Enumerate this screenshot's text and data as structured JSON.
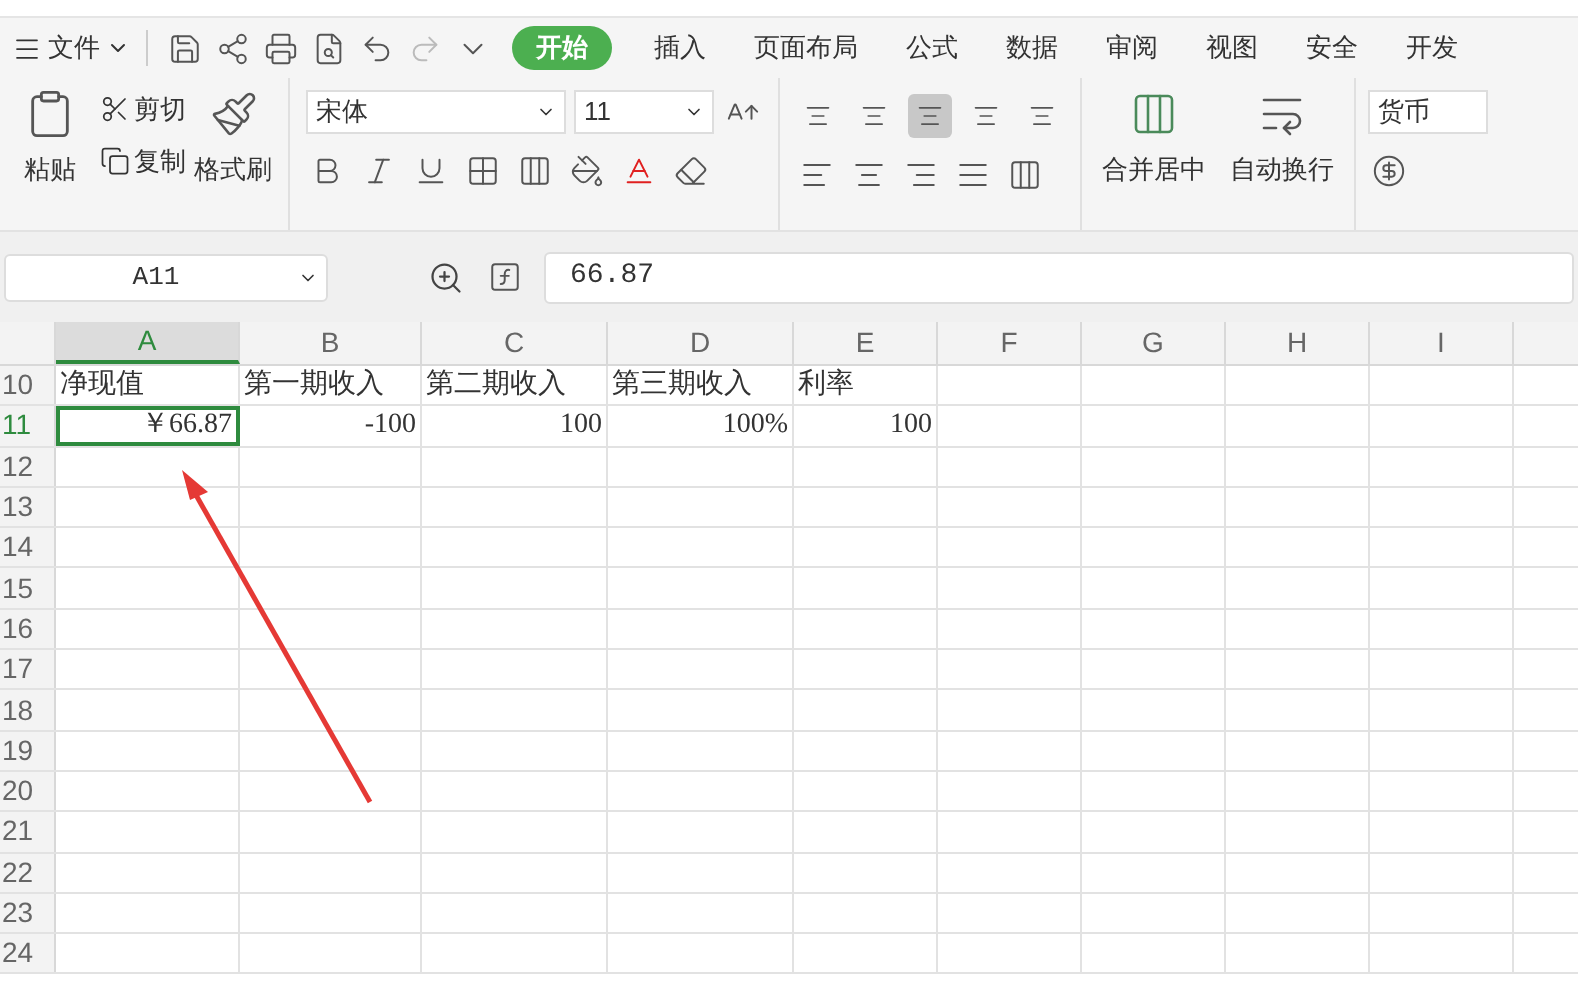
{
  "menu": {
    "label": "文件"
  },
  "tabs": [
    {
      "label": "开始",
      "selected": true
    },
    {
      "label": "插入",
      "selected": false
    },
    {
      "label": "页面布局",
      "selected": false
    },
    {
      "label": "公式",
      "selected": false
    },
    {
      "label": "数据",
      "selected": false
    },
    {
      "label": "审阅",
      "selected": false
    },
    {
      "label": "视图",
      "selected": false
    },
    {
      "label": "安全",
      "selected": false
    },
    {
      "label": "开发",
      "selected": false
    }
  ],
  "clipboard": {
    "paste": "粘贴",
    "cut": "剪切",
    "copy": "复制",
    "format_painter": "格式刷"
  },
  "font": {
    "name": "宋体",
    "size": "11"
  },
  "alignment": [
    {
      "selected": false
    },
    {
      "selected": false
    },
    {
      "selected": true
    },
    {
      "selected": false
    },
    {
      "selected": false
    }
  ],
  "merge": {
    "label": "合并居中"
  },
  "wrap": {
    "label": "自动换行"
  },
  "number_format": {
    "value": "货币"
  },
  "formula_bar": {
    "name_box": "A11",
    "value": "66.87"
  },
  "columns": [
    {
      "label": "A",
      "selected": true
    },
    {
      "label": "B",
      "selected": false
    },
    {
      "label": "C",
      "selected": false
    },
    {
      "label": "D",
      "selected": false
    },
    {
      "label": "E",
      "selected": false
    },
    {
      "label": "F",
      "selected": false
    },
    {
      "label": "G",
      "selected": false
    },
    {
      "label": "H",
      "selected": false
    },
    {
      "label": "I",
      "selected": false
    }
  ],
  "rows": [
    {
      "number": "10",
      "selected": false,
      "cells": [
        {
          "text": "净现值",
          "kind": "text"
        },
        {
          "text": "第一期收入",
          "kind": "text"
        },
        {
          "text": "第二期收入",
          "kind": "text"
        },
        {
          "text": "第三期收入",
          "kind": "text"
        },
        {
          "text": "利率",
          "kind": "text"
        }
      ]
    },
    {
      "number": "11",
      "selected": true,
      "cells": [
        {
          "text": "￥66.87",
          "kind": "number",
          "selected": true
        },
        {
          "text": "-100",
          "kind": "number"
        },
        {
          "text": "100",
          "kind": "number"
        },
        {
          "text": "100%",
          "kind": "number"
        },
        {
          "text": "100",
          "kind": "number"
        }
      ]
    },
    {
      "number": "12",
      "selected": false,
      "cells": []
    },
    {
      "number": "13",
      "selected": false,
      "cells": []
    },
    {
      "number": "14",
      "selected": false,
      "cells": []
    },
    {
      "number": "15",
      "selected": false,
      "cells": []
    },
    {
      "number": "16",
      "selected": false,
      "cells": []
    },
    {
      "number": "17",
      "selected": false,
      "cells": []
    },
    {
      "number": "18",
      "selected": false,
      "cells": []
    },
    {
      "number": "19",
      "selected": false,
      "cells": []
    },
    {
      "number": "20",
      "selected": false,
      "cells": []
    },
    {
      "number": "21",
      "selected": false,
      "cells": []
    },
    {
      "number": "22",
      "selected": false,
      "cells": []
    },
    {
      "number": "23",
      "selected": false,
      "cells": []
    },
    {
      "number": "24",
      "selected": false,
      "cells": []
    }
  ]
}
